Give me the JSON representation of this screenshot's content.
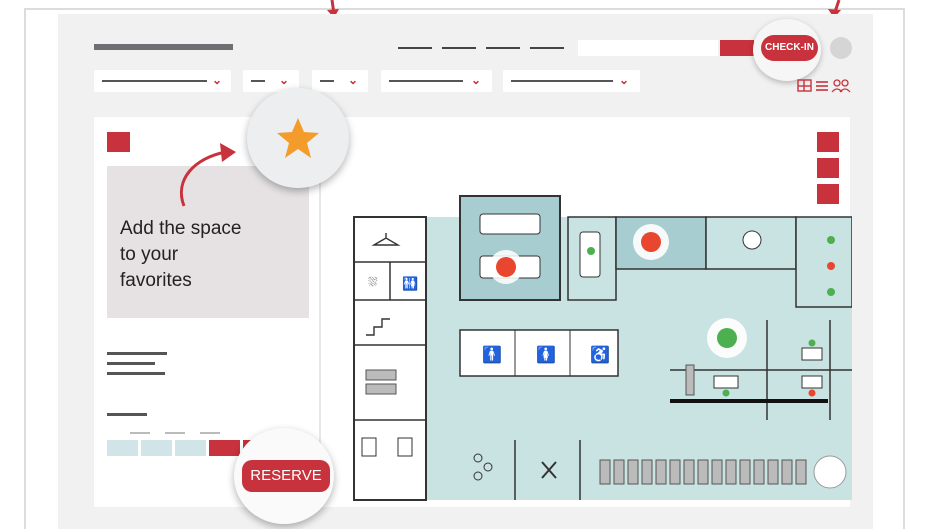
{
  "header": {
    "checkin_label": "CHECK-IN"
  },
  "callout": {
    "line1": "Add the space",
    "line2": "to your",
    "line3": "favorites"
  },
  "card": {
    "reserve_label": "RESERVE"
  },
  "icons": {
    "favorite": "star-icon",
    "view_switch": [
      "floorplan-icon",
      "list-icon",
      "people-icon"
    ]
  },
  "colors": {
    "accent": "#c8323c",
    "floor": "#c9e3e2",
    "room": "#a8cdd0",
    "available": "#4caf50",
    "occupied": "#e8462e",
    "star": "#f39c2b"
  }
}
